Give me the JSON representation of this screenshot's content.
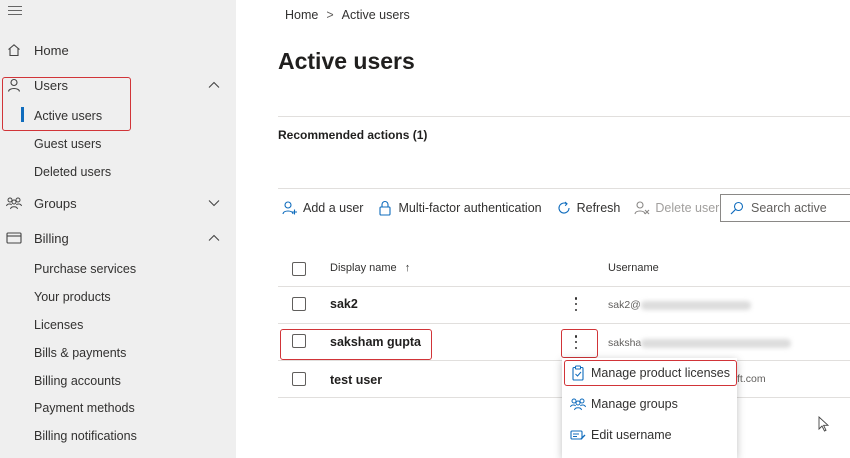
{
  "sidebar": {
    "home": "Home",
    "users": "Users",
    "users_sub": [
      "Active users",
      "Guest users",
      "Deleted users"
    ],
    "groups": "Groups",
    "billing": "Billing",
    "billing_sub": [
      "Purchase services",
      "Your products",
      "Licenses",
      "Bills & payments",
      "Billing accounts",
      "Payment methods",
      "Billing notifications"
    ]
  },
  "breadcrumb": {
    "home": "Home",
    "sep": ">",
    "current": "Active users"
  },
  "page_title": "Active users",
  "recommended": "Recommended actions (1)",
  "toolbar": {
    "add_user": "Add a user",
    "mfa": "Multi-factor authentication",
    "refresh": "Refresh",
    "delete_user": "Delete user",
    "search_placeholder": "Search active"
  },
  "table": {
    "headers": {
      "display_name": "Display name",
      "sort_arrow": "↑",
      "username": "Username"
    },
    "rows": [
      {
        "name": "sak2",
        "username_visible": "sak2@"
      },
      {
        "name": "saksham gupta",
        "username_visible": "saksha"
      },
      {
        "name": "test user",
        "username_visible": "ft.com"
      }
    ]
  },
  "context_menu": {
    "items": [
      "Manage product licenses",
      "Manage groups",
      "Edit username"
    ]
  },
  "colors": {
    "accent": "#0f6cbd",
    "highlight": "#d13438",
    "sidebar_bg": "#efefef"
  }
}
